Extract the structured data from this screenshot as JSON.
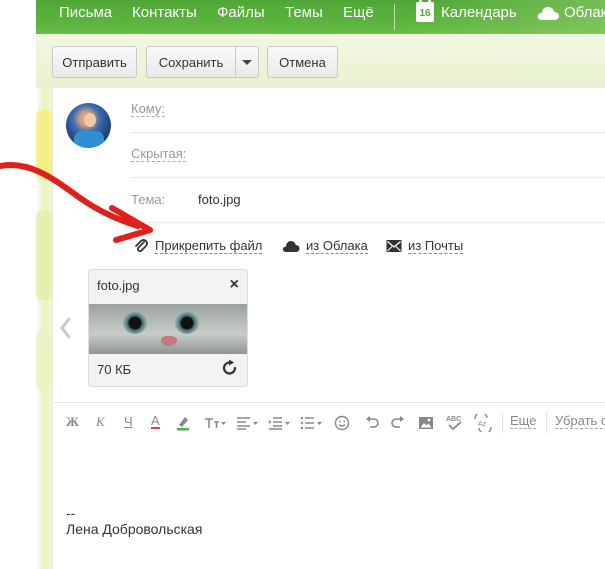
{
  "nav": {
    "items": [
      "Письма",
      "Контакты",
      "Файлы",
      "Темы",
      "Ещё"
    ],
    "calendar_day": "16",
    "calendar_label": "Календарь",
    "cloud_label": "Облак"
  },
  "toolbar": {
    "send_label": "Отправить",
    "save_label": "Сохранить",
    "cancel_label": "Отмена"
  },
  "compose": {
    "to_label": "Кому:",
    "bcc_label": "Скрытая:",
    "subject_label": "Тема:",
    "subject_value": "foto.jpg",
    "attach_file_label": "Прикрепить файл",
    "from_cloud_label": "из Облака",
    "from_mail_label": "из Почты"
  },
  "attachment": {
    "name": "foto.jpg",
    "size": "70 КБ",
    "close_glyph": "×"
  },
  "format_toolbar": {
    "bold": "Ж",
    "italic": "К",
    "underline": "Ч",
    "font_color": "А",
    "more_label": "Еще",
    "remove_format_label": "Убрать о"
  },
  "signature": {
    "dash": "--",
    "name": "Лена Добровольская"
  },
  "colors": {
    "nav_green": "#5db53e",
    "arrow_red": "#e0201c"
  }
}
